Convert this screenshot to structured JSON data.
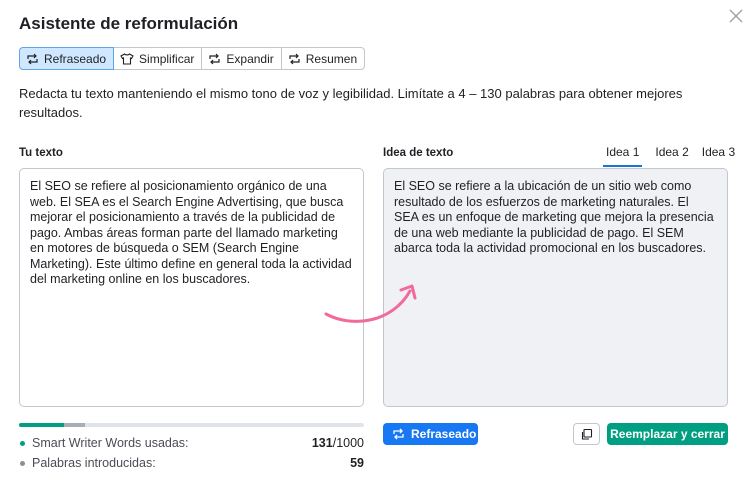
{
  "dialog": {
    "title": "Asistente de reformulación",
    "close_icon": "close-icon"
  },
  "modes": [
    {
      "label": "Refraseado",
      "icon": "rephrase-icon",
      "active": true
    },
    {
      "label": "Simplificar",
      "icon": "shirt-icon",
      "active": false
    },
    {
      "label": "Expandir",
      "icon": "rephrase-icon",
      "active": false
    },
    {
      "label": "Resumen",
      "icon": "rephrase-icon",
      "active": false
    }
  ],
  "description": "Redacta tu texto manteniendo el mismo tono de voz y legibilidad. Limítate a 4 – 130 palabras para obtener mejores resultados.",
  "input": {
    "label": "Tu texto",
    "text": "El SEO se refiere al posicionamiento orgánico de una web. El SEA es el Search Engine Advertising, que busca mejorar el posicionamiento a través de la publicidad de pago. Ambas áreas forman parte del llamado marketing en motores de búsqueda o SEM (Search Engine Marketing). Este último define en general toda la actividad del marketing online en los buscadores."
  },
  "output": {
    "label": "Idea de texto",
    "tabs": [
      "Idea 1",
      "Idea 2",
      "Idea 3"
    ],
    "active_tab": 0,
    "text": "El SEO se refiere a la ubicación de un sitio web como resultado de los esfuerzos de marketing naturales. El SEA es un enfoque de marketing que mejora la presencia de una web mediante la publicidad de pago. El SEM abarca toda la actividad promocional en los buscadores."
  },
  "usage": {
    "words_used_label": "Smart Writer Words usadas:",
    "words_used": "131",
    "words_limit": "/1000",
    "words_used_fraction": 0.131,
    "words_entered_label": "Palabras introducidas:",
    "words_entered": "59",
    "words_entered_fraction": 0.059
  },
  "buttons": {
    "rephrase": "Refraseado",
    "copy_icon": "copy-icon",
    "replace_close": "Reemplazar y cerrar"
  },
  "colors": {
    "accent_blue": "#1877f2",
    "accent_green": "#009f81",
    "arrow_pink": "#f06b9c",
    "active_mode_bg": "#cfe8ff"
  }
}
